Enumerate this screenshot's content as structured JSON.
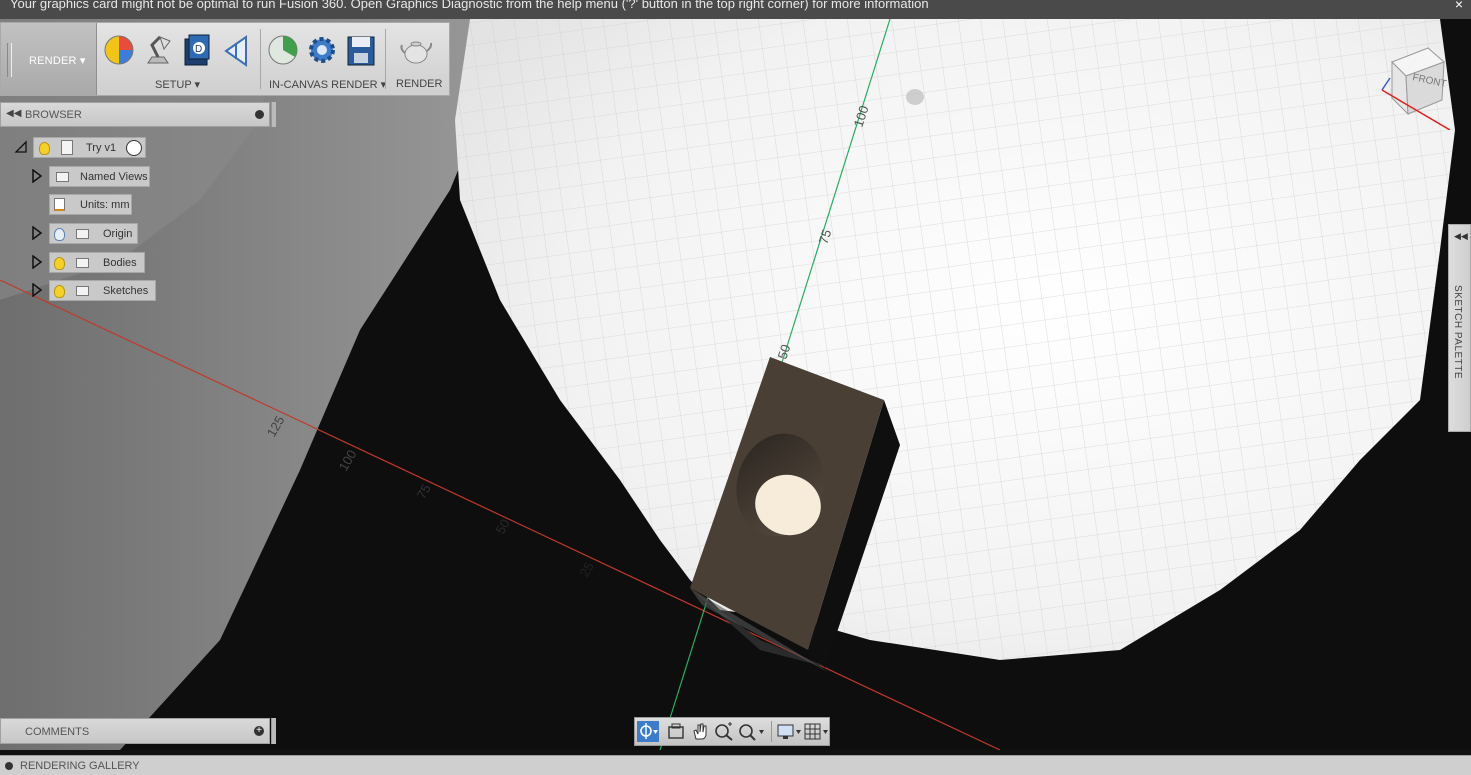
{
  "banner": {
    "message": "Your graphics card might not be optimal to run Fusion 360. Open Graphics Diagnostic from the help menu ('?' button in the top right corner) for more information",
    "close": "×"
  },
  "toolbar": {
    "workspace": "RENDER ▾",
    "groups": {
      "setup": "SETUP ▾",
      "in_canvas": "IN-CANVAS RENDER ▾",
      "render": "RENDER"
    }
  },
  "browser": {
    "title": "BROWSER",
    "root": "Try v1",
    "items": [
      {
        "label": "Named Views"
      },
      {
        "label": "Units: mm"
      },
      {
        "label": "Origin"
      },
      {
        "label": "Bodies"
      },
      {
        "label": "Sketches"
      }
    ]
  },
  "comments": {
    "title": "COMMENTS"
  },
  "gallery": {
    "title": "RENDERING GALLERY"
  },
  "sketch_palette": {
    "label": "SKETCH PALETTE"
  },
  "viewcube": {
    "face": "FRONT"
  },
  "axis_labels": {
    "green": [
      "100",
      "75",
      "50"
    ],
    "red": [
      "125",
      "100",
      "75",
      "50",
      "25"
    ]
  },
  "colors": {
    "x_axis": "#c0392b",
    "y_axis": "#27ae60",
    "body": "#4a3f35",
    "toolbar_accent": "#3d7cc9"
  }
}
